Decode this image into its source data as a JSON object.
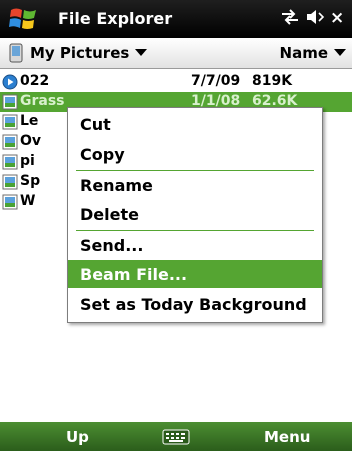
{
  "title_bar": {
    "title": "File Explorer",
    "icons": [
      "windows-start-icon",
      "connectivity-icon",
      "volume-icon",
      "close-icon"
    ],
    "close_label": "×"
  },
  "folder_bar": {
    "folder": "My Pictures",
    "sort": "Name"
  },
  "files": [
    {
      "name": "022",
      "date": "7/7/09",
      "size": "819K",
      "icon": "media-icon",
      "selected": false
    },
    {
      "name": "Grass",
      "date": "1/1/08",
      "size": "62.6K",
      "icon": "picture-icon",
      "selected": true
    },
    {
      "name": "Le",
      "date": "",
      "size": "",
      "icon": "picture-icon",
      "selected": false
    },
    {
      "name": "Ov",
      "date": "",
      "size": "",
      "icon": "picture-icon",
      "selected": false
    },
    {
      "name": "pi",
      "date": "",
      "size": "",
      "icon": "picture-icon",
      "selected": false
    },
    {
      "name": "Sp",
      "date": "",
      "size": "",
      "icon": "picture-icon",
      "selected": false
    },
    {
      "name": "W",
      "date": "",
      "size": "",
      "icon": "picture-icon",
      "selected": false
    }
  ],
  "context_menu": {
    "items": [
      {
        "label": "Cut",
        "highlighted": false
      },
      {
        "label": "Copy",
        "highlighted": false
      },
      {
        "label": "Rename",
        "highlighted": false
      },
      {
        "label": "Delete",
        "highlighted": false
      },
      {
        "label": "Send...",
        "highlighted": false
      },
      {
        "label": "Beam File...",
        "highlighted": true
      },
      {
        "label": "Set as Today Background",
        "highlighted": false
      }
    ]
  },
  "soft_keys": {
    "left": "Up",
    "right": "Menu",
    "keyboard_icon": "keyboard-icon"
  },
  "colors": {
    "accent": "#55a532",
    "title_bar": "#000000",
    "soft_bar": "#3a7626",
    "background": "#ffffff"
  }
}
